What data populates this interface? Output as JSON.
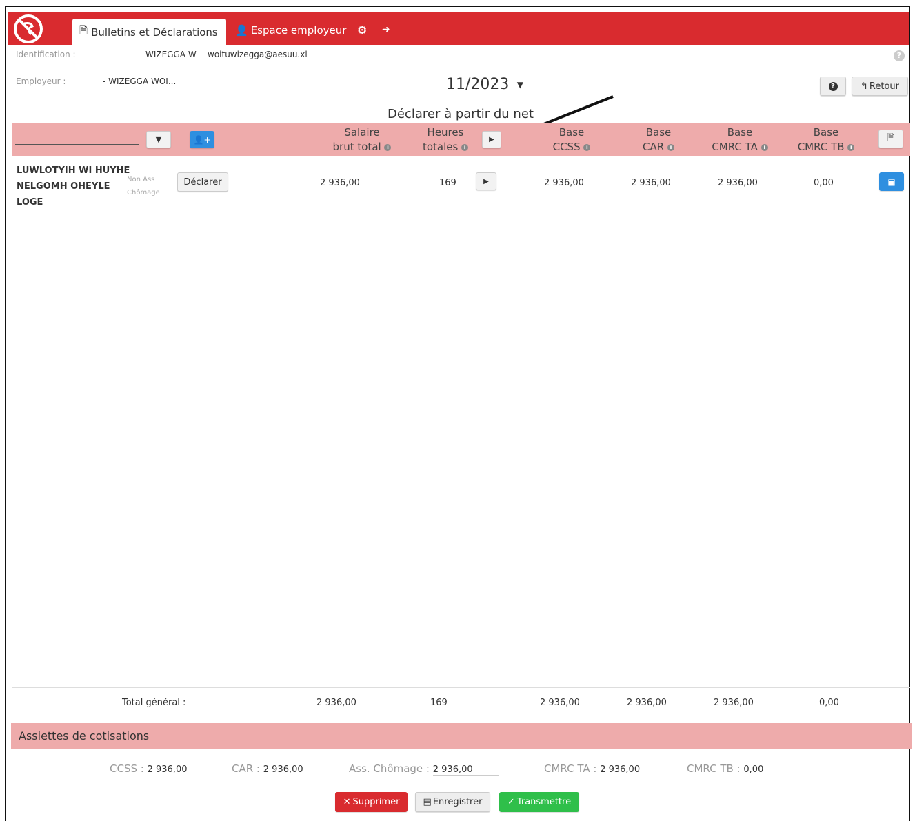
{
  "header": {
    "tabs": [
      {
        "label": "Bulletins et Déclarations",
        "active": true
      },
      {
        "label": "Espace employeur",
        "active": false
      }
    ]
  },
  "info": {
    "identification_label": "Identification :",
    "identification_name": "WIZEGGA W",
    "identification_email": "woituwizegga@aesuu.xl",
    "employeur_label": "Employeur :",
    "employeur_value": "- WIZEGGA WOI..."
  },
  "period": "11/2023",
  "buttons": {
    "retour": "Retour",
    "declarer": "Déclarer",
    "supprimer": "Supprimer",
    "enregistrer": "Enregistrer",
    "transmettre": "Transmettre"
  },
  "section_title": "Déclarer à partir du net",
  "columns": [
    {
      "line1": "Salaire",
      "line2": "brut total"
    },
    {
      "line1": "Heures",
      "line2": "totales"
    },
    {
      "line1": "Base",
      "line2": "CCSS"
    },
    {
      "line1": "Base",
      "line2": "CAR"
    },
    {
      "line1": "Base",
      "line2": "CMRC TA"
    },
    {
      "line1": "Base",
      "line2": "CMRC TB"
    }
  ],
  "rows": [
    {
      "name_lines": [
        "LUWLOTYIH WI HUYHE",
        "NELGOMH OHEYLE",
        "LOGE"
      ],
      "status_lines": [
        "Non Ass",
        "Chômage"
      ],
      "values": [
        "2 936,00",
        "169",
        "2 936,00",
        "2 936,00",
        "2 936,00",
        "0,00"
      ]
    }
  ],
  "total": {
    "label": "Total général :",
    "values": [
      "2 936,00",
      "169",
      "2 936,00",
      "2 936,00",
      "2 936,00",
      "0,00"
    ]
  },
  "assiettes": {
    "title": "Assiettes de cotisations",
    "items": [
      {
        "label": "CCSS :",
        "value": "2 936,00"
      },
      {
        "label": "CAR :",
        "value": "2 936,00"
      },
      {
        "label": "Ass. Chômage :",
        "value": "2 936,00"
      },
      {
        "label": "CMRC TA :",
        "value": "2 936,00"
      },
      {
        "label": "CMRC TB :",
        "value": "0,00"
      }
    ]
  },
  "colors": {
    "brand_red": "#d92b2f",
    "header_pink": "#eeabab",
    "primary_blue": "#2e8fe0",
    "success_green": "#2fbf4a"
  }
}
